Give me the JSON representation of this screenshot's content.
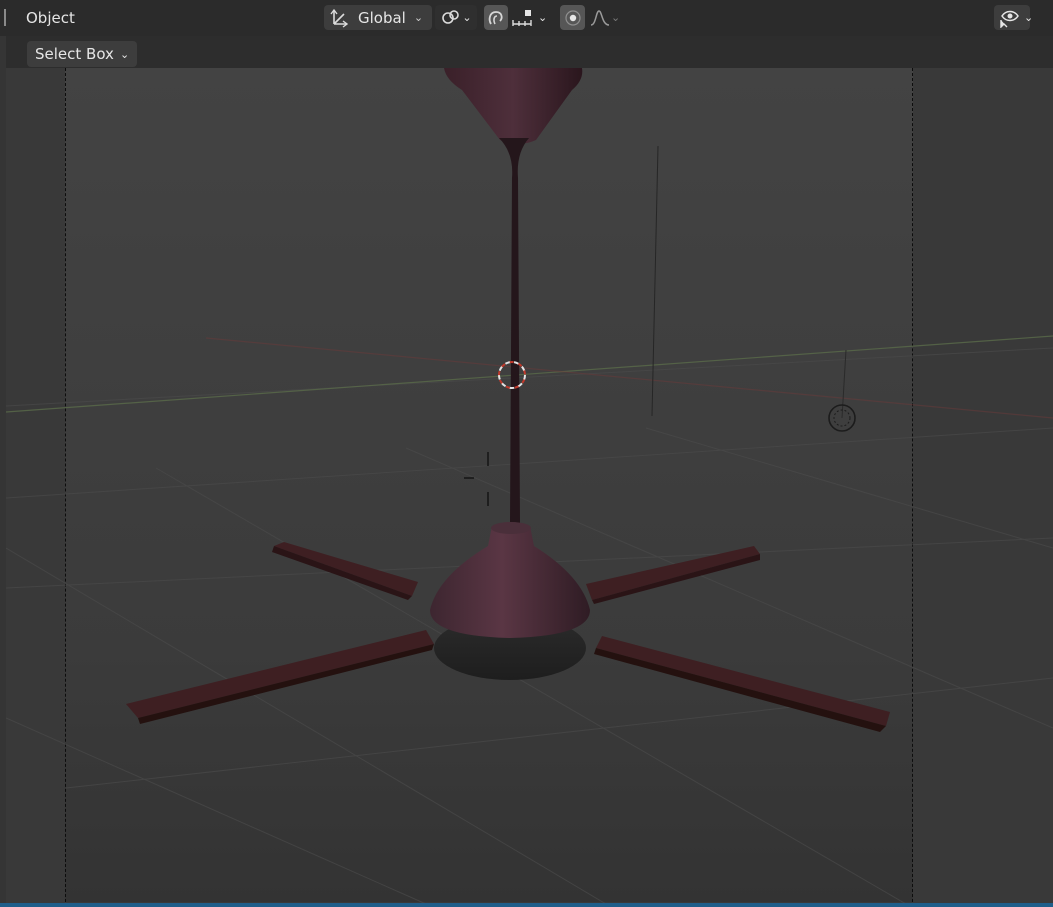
{
  "header": {
    "mode_label": "Object",
    "orientation": {
      "label": "Global",
      "icon": "transform-orientation-icon"
    },
    "pivot": {
      "icon": "pivot-link-icon"
    },
    "snap": {
      "icon": "snap-magnet-icon",
      "increment_icon": "snap-increment-icon"
    },
    "proportional": {
      "icon": "proportional-editing-icon",
      "falloff_icon": "falloff-curve-icon"
    },
    "visibility": {
      "icon": "selectability-visibility-icon"
    }
  },
  "tool_settings": {
    "select_mode": "Select Box"
  },
  "viewport": {
    "object": "ceiling-fan",
    "colors": {
      "fan_material": "#4a2a35",
      "blade": "#3e1f22",
      "grid_x_axis": "#6b3a3a",
      "grid_y_axis": "#5a6b4a",
      "status_bar": "#1f5e8a"
    }
  }
}
